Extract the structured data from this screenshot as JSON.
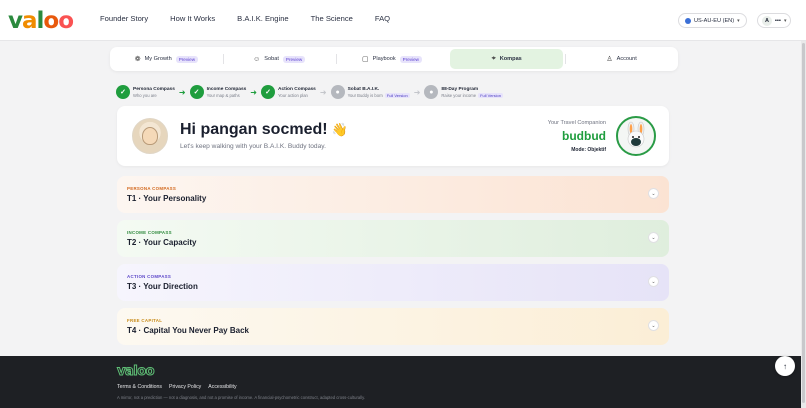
{
  "brand": {
    "logo_letters": [
      "v",
      "a",
      "l",
      "o",
      "o"
    ],
    "logo_colors": [
      "#2b8a3e",
      "#f08c00",
      "#2b8a3e",
      "#e8590c",
      "#fa5252"
    ]
  },
  "nav": {
    "links": [
      "Founder Story",
      "How It Works",
      "B.A.I.K. Engine",
      "The Science",
      "FAQ"
    ],
    "locale": "US-AU-EU (EN)",
    "user_initial": "A",
    "user_label": "▪▪▪"
  },
  "tabs": [
    {
      "label": "My Growth",
      "badge": "Preview",
      "icon": "sprout-icon",
      "glyph": "❁"
    },
    {
      "label": "Sobat",
      "badge": "Preview",
      "icon": "people-icon",
      "glyph": "☺"
    },
    {
      "label": "Playbook",
      "badge": "Preview",
      "icon": "book-icon",
      "glyph": "▢"
    },
    {
      "label": "Kompas",
      "badge": "",
      "icon": "compass-icon",
      "glyph": "⌖",
      "active": true
    },
    {
      "label": "Account",
      "badge": "",
      "icon": "user-icon",
      "glyph": "♙"
    }
  ],
  "stepper": [
    {
      "title": "Persona Compass",
      "subtitle": "Who you are",
      "status": "done",
      "tag": ""
    },
    {
      "title": "Income Compass",
      "subtitle": "Your map & paths",
      "status": "done",
      "tag": ""
    },
    {
      "title": "Action Compass",
      "subtitle": "Your action plan",
      "status": "done",
      "tag": ""
    },
    {
      "title": "Sobat B.A.I.K.",
      "subtitle": "Your Buddy is born",
      "status": "locked",
      "tag": "Full Version"
    },
    {
      "title": "88-Day Program",
      "subtitle": "Raise your income",
      "status": "locked",
      "tag": "Full Version"
    }
  ],
  "hero": {
    "greeting": "Hi pangan socmed!",
    "wave": "👋",
    "subtitle": "Let's keep walking with your B.A.I.K. Buddy today.",
    "companion_label": "Your Travel Companion",
    "companion_name": "budbud",
    "companion_mode": "Mode: Objektif"
  },
  "accordion": [
    {
      "tag": "PERSONA COMPASS",
      "title": "T1 · Your Personality"
    },
    {
      "tag": "INCOME COMPASS",
      "title": "T2 · Your Capacity"
    },
    {
      "tag": "ACTION COMPASS",
      "title": "T3 · Your Direction"
    },
    {
      "tag": "FREE CAPITAL",
      "title": "T4 · Capital You Never Pay Back"
    }
  ],
  "footer": {
    "links": [
      "Terms & Conditions",
      "Privacy Policy",
      "Accessibility"
    ],
    "note": "A mirror, not a prediction — not a diagnosis, and not a promise of income. A financial-psychometric construct, adapted cross-culturally."
  },
  "colors": {
    "accent_green": "#1f9d3e",
    "preview_purple": "#5b3fd0",
    "footer_bg": "#1e2024"
  }
}
